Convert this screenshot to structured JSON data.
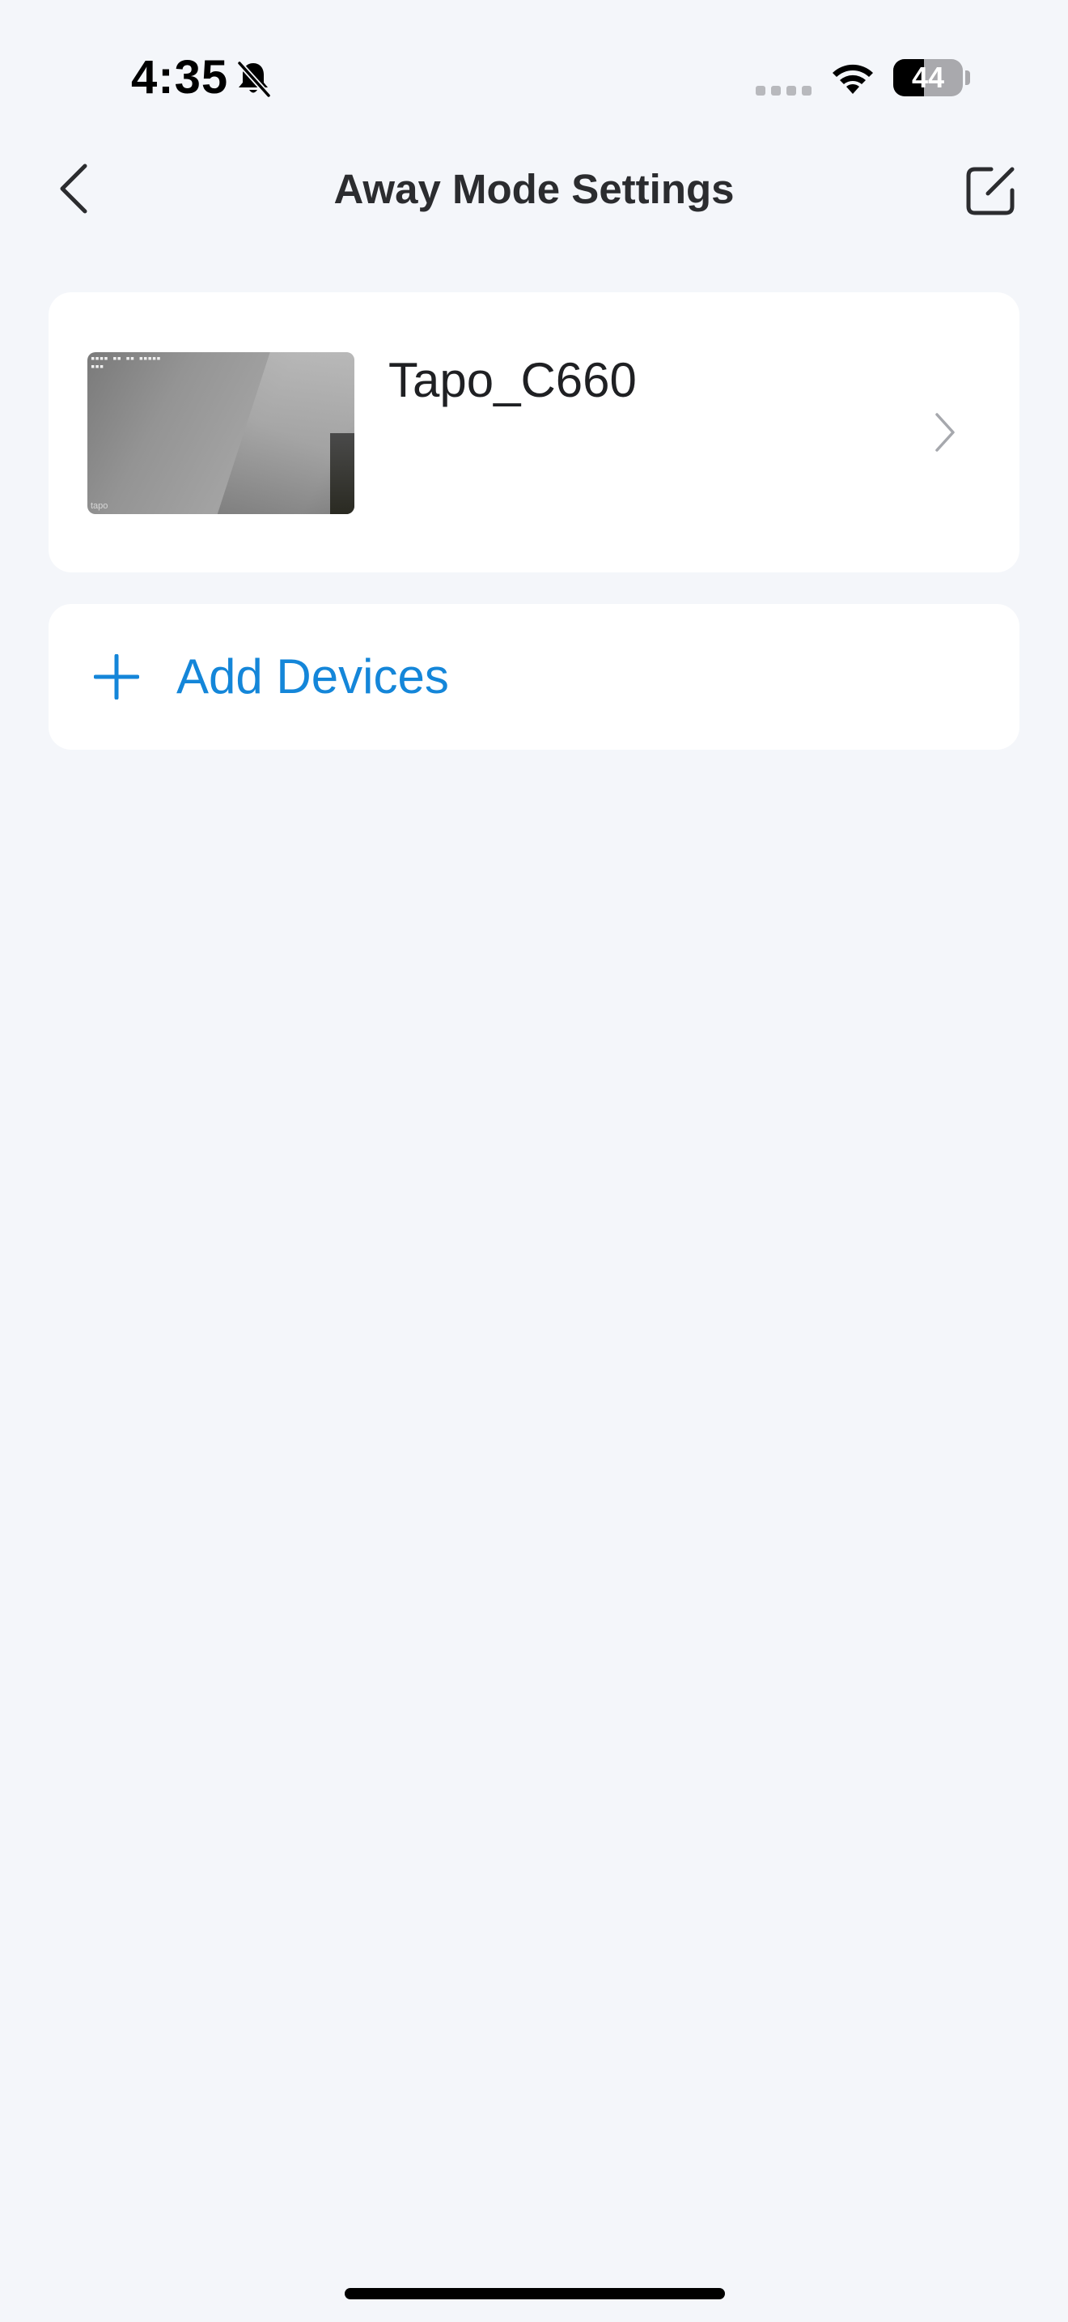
{
  "status_bar": {
    "time": "4:35",
    "battery_level": 44,
    "battery_text": "44"
  },
  "header": {
    "title": "Away Mode Settings",
    "back_icon": "chevron-left-icon",
    "edit_icon": "edit-square-icon"
  },
  "devices": [
    {
      "name": "Tapo_C660",
      "thumbnail_watermark": "tapo"
    }
  ],
  "add_devices": {
    "label": "Add Devices",
    "icon": "plus-icon"
  },
  "colors": {
    "background": "#f4f6fa",
    "card": "#ffffff",
    "accent": "#1486d9",
    "title_text": "#2b2c2f"
  }
}
